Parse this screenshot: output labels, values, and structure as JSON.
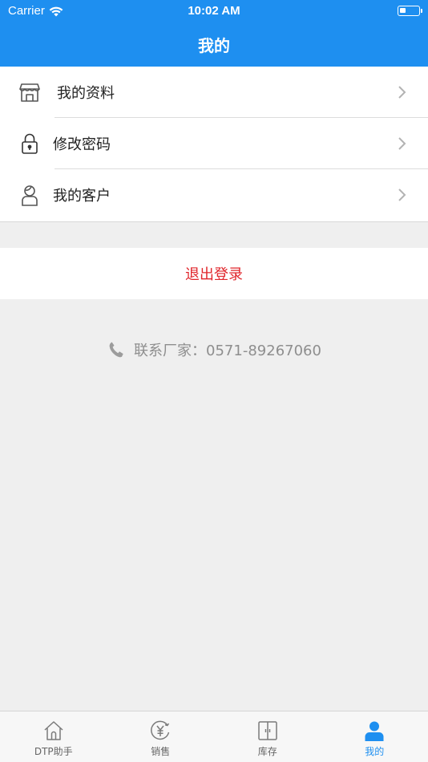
{
  "status_bar": {
    "carrier": "Carrier",
    "time": "10:02 AM"
  },
  "header": {
    "title": "我的"
  },
  "menu": {
    "items": [
      {
        "label": "我的资料",
        "icon": "store-icon"
      },
      {
        "label": "修改密码",
        "icon": "lock-icon"
      },
      {
        "label": "我的客户",
        "icon": "person-icon"
      }
    ]
  },
  "logout": {
    "label": "退出登录",
    "color": "#e0252b"
  },
  "contact": {
    "text": "联系厂家：0571-89267060",
    "icon": "phone-icon"
  },
  "tabbar": {
    "tabs": [
      {
        "label": "DTP助手",
        "icon": "home-icon",
        "active": false
      },
      {
        "label": "销售",
        "icon": "sales-yen-icon",
        "active": false
      },
      {
        "label": "库存",
        "icon": "inventory-icon",
        "active": false
      },
      {
        "label": "我的",
        "icon": "user-icon",
        "active": true
      }
    ]
  },
  "colors": {
    "accent": "#1e8ff0",
    "background": "#efefef",
    "logout": "#e0252b"
  }
}
